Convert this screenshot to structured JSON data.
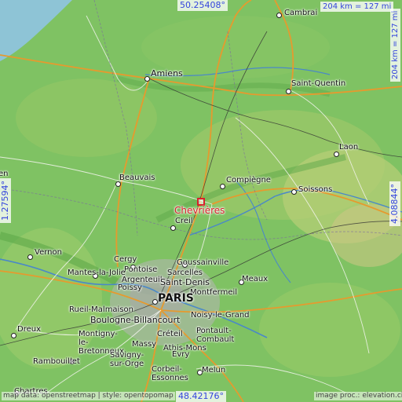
{
  "map": {
    "target": {
      "name": "Chevrières"
    },
    "coordinates": {
      "north": "50.25408°",
      "south": "48.42176°",
      "west": "1.27594°",
      "east": "4.08844°"
    },
    "scale": {
      "horizontal": "204 km = 127 mi",
      "vertical": "204 km = 127 mi"
    },
    "credits": {
      "left": "map data: openstreetmap | style: opentopomap",
      "right": "image proc.: elevation.city"
    },
    "partial_labels": {
      "left_edge": "en"
    },
    "cities": [
      {
        "name": "Cambrai"
      },
      {
        "name": "Amiens"
      },
      {
        "name": "Saint-Quentin"
      },
      {
        "name": "Laon"
      },
      {
        "name": "Compiègne"
      },
      {
        "name": "Soissons"
      },
      {
        "name": "Beauvais"
      },
      {
        "name": "Creil"
      },
      {
        "name": "Vernon"
      },
      {
        "name": "Cergy"
      },
      {
        "name": "Pontoise"
      },
      {
        "name": "Goussainville"
      },
      {
        "name": "Sarcelles"
      },
      {
        "name": "Mantes-la-Jolie"
      },
      {
        "name": "Argenteuil"
      },
      {
        "name": "Saint-Denis"
      },
      {
        "name": "Poissy"
      },
      {
        "name": "Meaux"
      },
      {
        "name": "Montfermeil"
      },
      {
        "name": "PARIS"
      },
      {
        "name": "Rueil-Malmaison"
      },
      {
        "name": "Noisy-le-Grand"
      },
      {
        "name": "Boulogne-Billancourt"
      },
      {
        "name": "Dreux"
      },
      {
        "name": "Montigny-le-Bretonneux"
      },
      {
        "name": "Créteil"
      },
      {
        "name": "Pontault-Combault"
      },
      {
        "name": "Massy"
      },
      {
        "name": "Athis-Mons"
      },
      {
        "name": "Rambouillet"
      },
      {
        "name": "Savigny-sur-Orge"
      },
      {
        "name": "Évry"
      },
      {
        "name": "Corbeil-Essonnes"
      },
      {
        "name": "Melun"
      },
      {
        "name": "Chartres"
      }
    ]
  }
}
